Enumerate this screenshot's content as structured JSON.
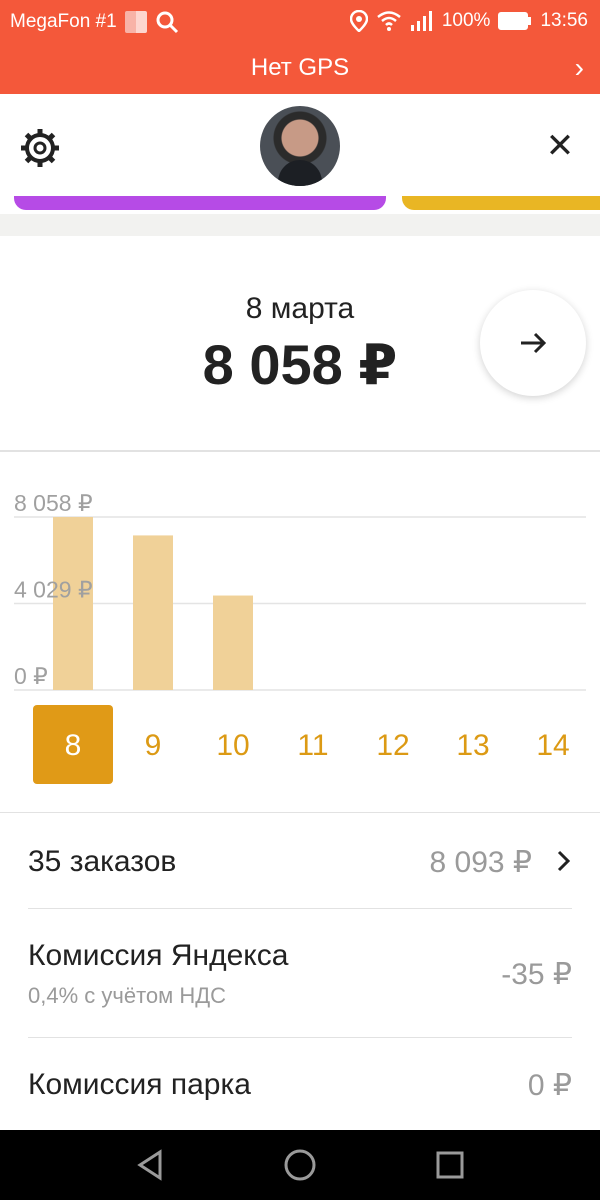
{
  "status_bar": {
    "carrier": "MegaFon #1",
    "battery": "100%",
    "time": "13:56"
  },
  "gps_banner": {
    "title": "Нет GPS"
  },
  "summary": {
    "date": "8 марта",
    "amount": "8 058 ₽"
  },
  "chart_data": {
    "type": "bar",
    "categories": [
      "8",
      "9",
      "10",
      "11",
      "12",
      "13",
      "14"
    ],
    "values": [
      8058,
      7200,
      4400,
      0,
      0,
      0,
      0
    ],
    "ylim": [
      0,
      8058
    ],
    "ytick_labels": [
      "0 ₽",
      "4 029 ₽",
      "8 058 ₽"
    ],
    "ytick_values": [
      0,
      4029,
      8058
    ],
    "selected": "8",
    "grid": true,
    "colors": {
      "bar": "#f0d198",
      "selected": "#e09a17",
      "label": "#dc9a14"
    }
  },
  "details": {
    "orders": {
      "label": "35 заказов",
      "value": "8 093 ₽"
    },
    "yandex_commission": {
      "label": "Комиссия Яндекса",
      "sub": "0,4% с учётом НДС",
      "value": "-35 ₽"
    },
    "park_commission": {
      "label": "Комиссия парка",
      "value": "0 ₽"
    }
  },
  "colors": {
    "accent": "#f4583a",
    "purple": "#b64be6",
    "yellow": "#e9b624"
  }
}
